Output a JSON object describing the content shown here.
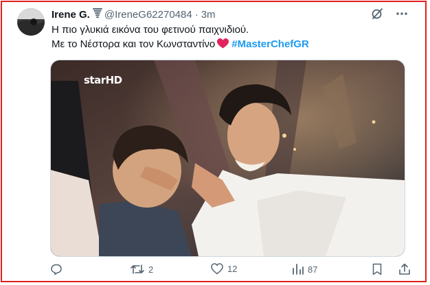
{
  "tweet": {
    "display_name": "Irene G.",
    "handle": "@IreneG62270484",
    "separator": "·",
    "time": "3m",
    "line1": "Η πιο γλυκιά εικόνα του φετινού παιχνιδιού.",
    "line2": "Με το Νέστορα και τον Κωνσταντίνο",
    "hashtag": "#MasterChefGR"
  },
  "media": {
    "channel_logo": "starHD"
  },
  "actions": {
    "reply_count": "",
    "retweet_count": "2",
    "like_count": "12",
    "views_count": "87"
  },
  "icons": {
    "badge": "tornado-icon",
    "grok": "grok-icon",
    "more": "more-icon",
    "heart_emoji": "heart-icon",
    "reply": "reply-icon",
    "retweet": "retweet-icon",
    "like": "like-icon",
    "views": "views-icon",
    "bookmark": "bookmark-icon",
    "share": "share-icon"
  },
  "colors": {
    "hashtag": "#1d9bf0",
    "muted": "#536471",
    "frame": "#e0201e",
    "heart": "#e0245e"
  }
}
